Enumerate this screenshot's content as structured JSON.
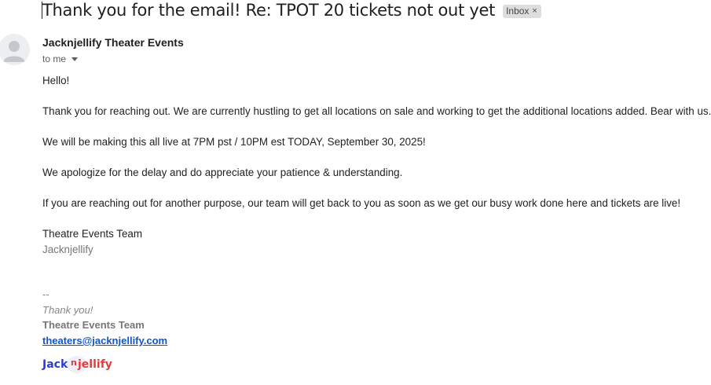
{
  "email": {
    "subject": "Thank you for the email! Re: TPOT 20 tickets not out yet",
    "label": "Inbox",
    "label_remove": "×",
    "sender": "Jacknjellify Theater Events",
    "recipient": "to me",
    "body": [
      "Hello!",
      "Thank you for reaching out. We are currently hustling to get all locations on sale and working to get the additional locations added. Bear with us.",
      "We will be making this all live at 7PM pst / 10PM est TODAY, September 30, 2025!",
      "We apologize for the delay and do appreciate your patience & understanding.",
      "If you are reaching out for another purpose, our team will get back to you as soon as we get our busy work done here and tickets are live!",
      "Theatre Events Team",
      "Jacknjellify"
    ],
    "signature": {
      "dash": "--",
      "thanks": "Thank you!",
      "team": "Theatre Events Team",
      "email": "theaters@jacknjellify.com",
      "logo": {
        "part1": "Jack",
        "part2": "n",
        "part3": "jellify"
      }
    }
  },
  "colors": {
    "link": "#1155cc",
    "logo_blue": "#2a3fd1",
    "logo_red": "#e23b3b"
  }
}
